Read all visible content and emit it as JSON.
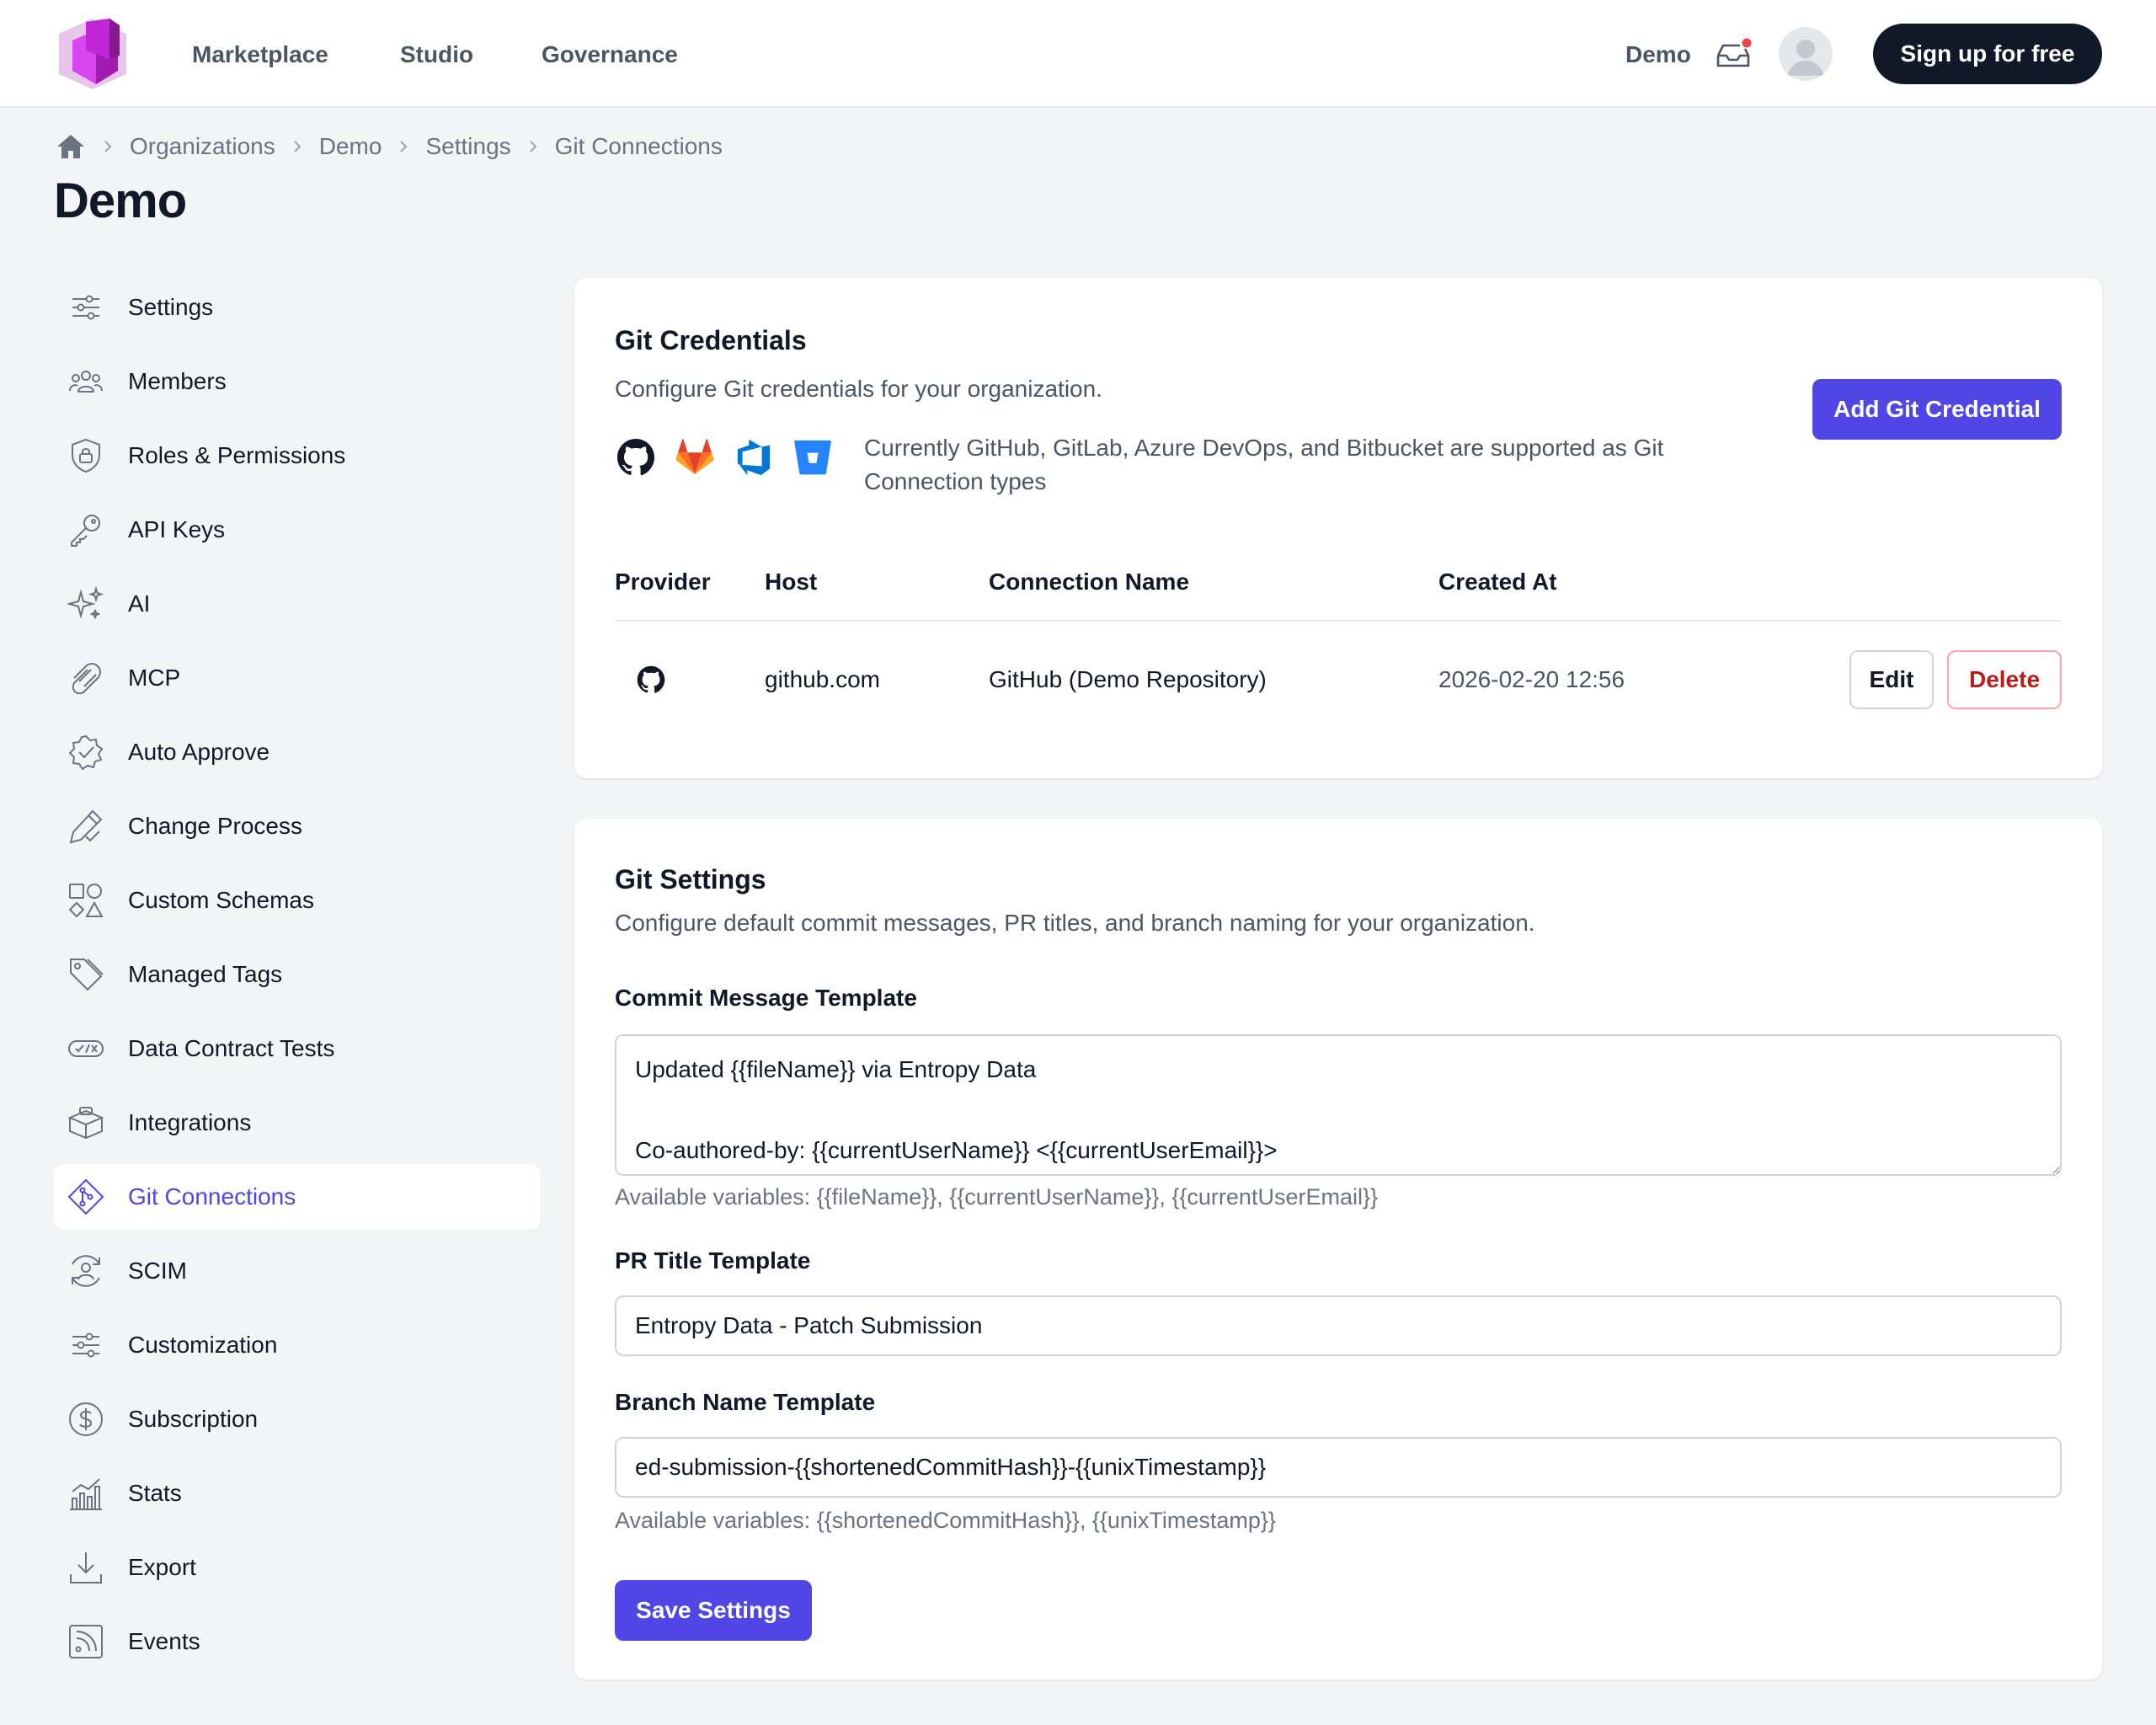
{
  "nav": {
    "links": [
      "Marketplace",
      "Studio",
      "Governance"
    ],
    "org": "Demo",
    "signup_label": "Sign up for free"
  },
  "breadcrumb": [
    "Organizations",
    "Demo",
    "Settings",
    "Git Connections"
  ],
  "page_title": "Demo",
  "sidebar": {
    "items": [
      {
        "label": "Settings",
        "icon": "sliders-icon"
      },
      {
        "label": "Members",
        "icon": "users-icon"
      },
      {
        "label": "Roles & Permissions",
        "icon": "shield-lock-icon"
      },
      {
        "label": "API Keys",
        "icon": "key-icon"
      },
      {
        "label": "AI",
        "icon": "sparkles-icon"
      },
      {
        "label": "MCP",
        "icon": "paperclip-icon"
      },
      {
        "label": "Auto Approve",
        "icon": "badge-check-icon"
      },
      {
        "label": "Change Process",
        "icon": "pencil-check-icon"
      },
      {
        "label": "Custom Schemas",
        "icon": "shapes-icon"
      },
      {
        "label": "Managed Tags",
        "icon": "tags-icon"
      },
      {
        "label": "Data Contract Tests",
        "icon": "test-badge-icon"
      },
      {
        "label": "Integrations",
        "icon": "puzzle-box-icon"
      },
      {
        "label": "Git Connections",
        "icon": "git-diamond-icon",
        "active": true
      },
      {
        "label": "SCIM",
        "icon": "user-sync-icon"
      },
      {
        "label": "Customization",
        "icon": "sliders-icon"
      },
      {
        "label": "Subscription",
        "icon": "dollar-circle-icon"
      },
      {
        "label": "Stats",
        "icon": "bar-chart-icon"
      },
      {
        "label": "Export",
        "icon": "download-icon"
      },
      {
        "label": "Events",
        "icon": "rss-icon"
      }
    ]
  },
  "credentials": {
    "title": "Git Credentials",
    "subtitle": "Configure Git credentials for your organization.",
    "add_label": "Add Git Credential",
    "supported_text": "Currently GitHub, GitLab, Azure DevOps, and Bitbucket are supported as Git Connection types",
    "columns": [
      "Provider",
      "Host",
      "Connection Name",
      "Created At"
    ],
    "rows": [
      {
        "provider_icon": "github-icon",
        "host": "github.com",
        "name": "GitHub (Demo Repository)",
        "created": "2026-02-20 12:56"
      }
    ],
    "edit_label": "Edit",
    "delete_label": "Delete"
  },
  "settings": {
    "title": "Git Settings",
    "subtitle": "Configure default commit messages, PR titles, and branch naming for your organization.",
    "commit_label": "Commit Message Template",
    "commit_value": "Updated {{fileName}} via Entropy Data\n\nCo-authored-by: {{currentUserName}} <{{currentUserEmail}}>",
    "commit_hint": "Available variables: {{fileName}}, {{currentUserName}}, {{currentUserEmail}}",
    "pr_label": "PR Title Template",
    "pr_value": "Entropy Data - Patch Submission",
    "branch_label": "Branch Name Template",
    "branch_value": "ed-submission-{{shortenedCommitHash}}-{{unixTimestamp}}",
    "branch_hint": "Available variables: {{shortenedCommitHash}}, {{unixTimestamp}}",
    "save_label": "Save Settings"
  },
  "colors": {
    "accent": "#4f46e5",
    "danger": "#b91c1c",
    "notification": "#ef4444"
  }
}
